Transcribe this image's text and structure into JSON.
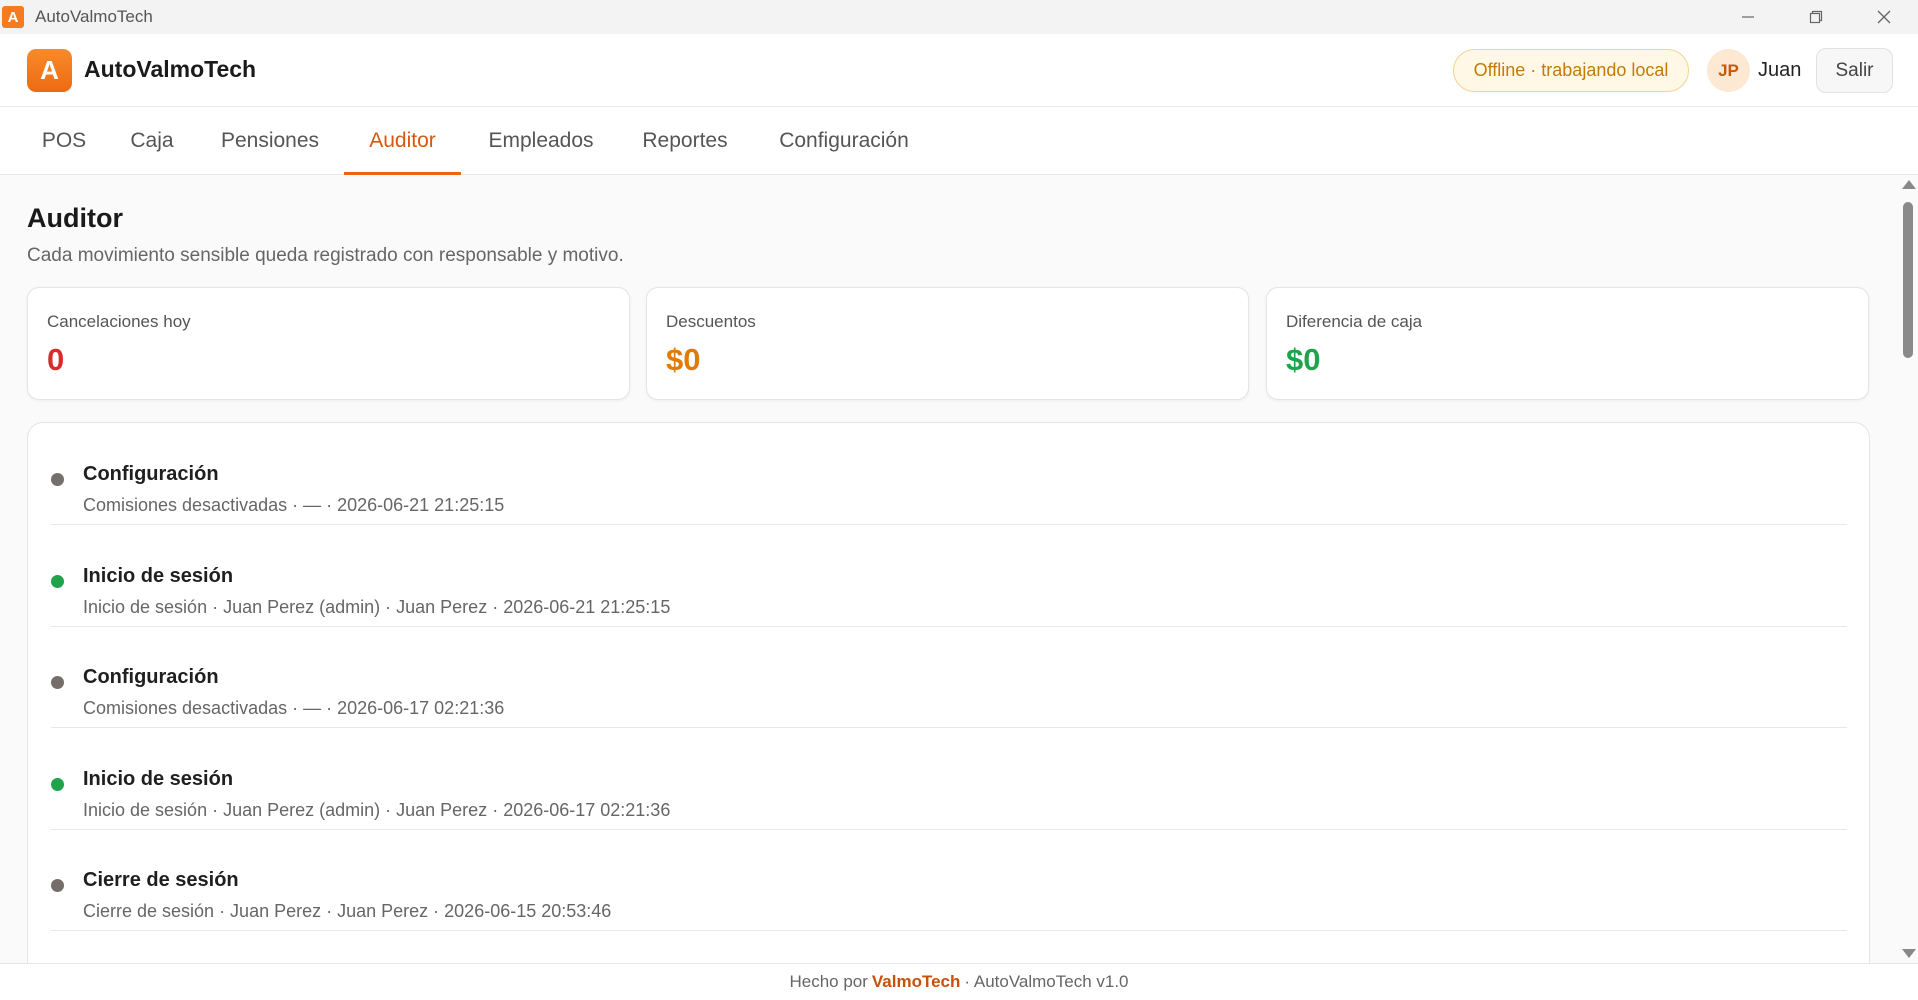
{
  "window": {
    "title": "AutoValmoTech",
    "logo_glyph": "A"
  },
  "header": {
    "brand_name": "AutoValmoTech",
    "logo_glyph": "A",
    "status_text": "Offline · trabajando local",
    "avatar_initials": "JP",
    "user_name": "Juan",
    "logout_label": "Salir"
  },
  "nav": {
    "tabs": [
      {
        "label": "POS",
        "active": false
      },
      {
        "label": "Caja",
        "active": false
      },
      {
        "label": "Pensiones",
        "active": false
      },
      {
        "label": "Auditor",
        "active": true
      },
      {
        "label": "Empleados",
        "active": false
      },
      {
        "label": "Reportes",
        "active": false
      },
      {
        "label": "Configuración",
        "active": false
      }
    ]
  },
  "page": {
    "title": "Auditor",
    "subtitle": "Cada movimiento sensible queda registrado con responsable y motivo."
  },
  "stats": [
    {
      "label": "Cancelaciones hoy",
      "value": "0",
      "color": "#d92b2b"
    },
    {
      "label": "Descuentos",
      "value": "$0",
      "color": "#e07b06"
    },
    {
      "label": "Diferencia de caja",
      "value": "$0",
      "color": "#1fa44b"
    }
  ],
  "log": [
    {
      "title": "Configuración",
      "meta": "Comisiones desactivadas · — · 2026-06-21 21:25:15",
      "dot_color": "#756e6a"
    },
    {
      "title": "Inicio de sesión",
      "meta": "Inicio de sesión · Juan Perez (admin) · Juan Perez · 2026-06-21 21:25:15",
      "dot_color": "#1fa44b"
    },
    {
      "title": "Configuración",
      "meta": "Comisiones desactivadas · — · 2026-06-17 02:21:36",
      "dot_color": "#756e6a"
    },
    {
      "title": "Inicio de sesión",
      "meta": "Inicio de sesión · Juan Perez (admin) · Juan Perez · 2026-06-17 02:21:36",
      "dot_color": "#1fa44b"
    },
    {
      "title": "Cierre de sesión",
      "meta": "Cierre de sesión · Juan Perez · Juan Perez · 2026-06-15 20:53:46",
      "dot_color": "#756e6a"
    }
  ],
  "footer": {
    "prefix": "Hecho por",
    "brand": "ValmoTech",
    "suffix": "· AutoValmoTech v1.0"
  }
}
